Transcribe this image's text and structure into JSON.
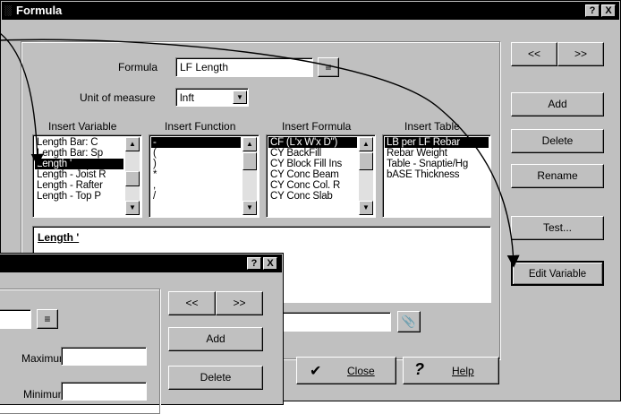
{
  "main_dialog": {
    "title": "Formula",
    "title_buttons": [
      "?",
      "X"
    ],
    "nav_prev": "<<",
    "nav_next": ">>",
    "formula_label": "Formula",
    "formula_value": "LF Length",
    "unit_label": "Unit of measure",
    "unit_value": "lnft",
    "insert_variable": {
      "label": "Insert Variable",
      "items": [
        "Length  Bar:  C",
        "Length  Bar:  Sp",
        "Length '",
        "Length - Joist R",
        "Length - Rafter",
        "Length - Top P"
      ],
      "selected_index": 2
    },
    "insert_function": {
      "label": "Insert Function",
      "items": [
        "-",
        "(",
        ")",
        "*",
        ",",
        "/"
      ],
      "selected_index": 0
    },
    "insert_formula": {
      "label": "Insert Formula",
      "items": [
        "CF (L'x W'x D\")",
        "CY BackFill",
        "CY Block Fill Ins",
        "CY Conc Beam",
        "CY Conc Col. R",
        "CY Conc Slab"
      ],
      "selected_index": 0
    },
    "insert_table": {
      "label": "Insert Table",
      "items": [
        "LB per LF Rebar",
        "Rebar Weight",
        "Table - Snaptie/Hg",
        "bASE Thickness"
      ],
      "selected_index": 0
    },
    "expression_text": "Length '",
    "buttons": {
      "add": "Add",
      "delete": "Delete",
      "rename": "Rename",
      "test": "Test...",
      "edit_variable": "Edit Variable",
      "close": "Close",
      "help": "Help"
    }
  },
  "variable_dialog": {
    "title_buttons": [
      "?",
      "X"
    ],
    "nav_prev": "<<",
    "nav_next": ">>",
    "maximum_label": "Maximum",
    "maximum_value": "",
    "minimum_label": "Minimum",
    "minimum_value": "",
    "buttons": {
      "add": "Add",
      "delete": "Delete"
    }
  },
  "annotation_colors": {
    "arrow": "#000000"
  }
}
